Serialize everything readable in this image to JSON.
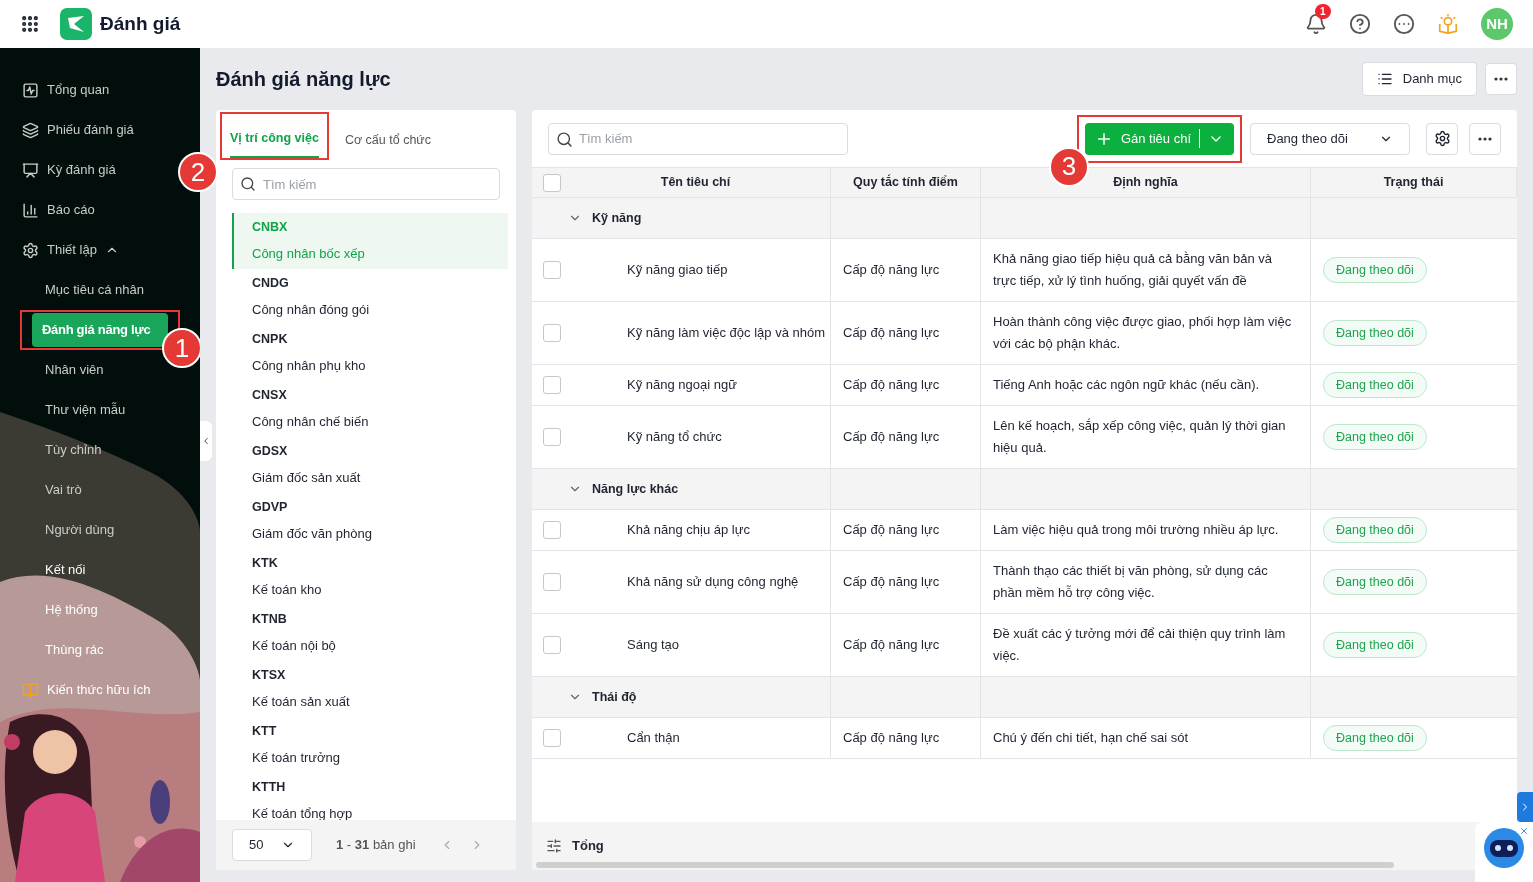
{
  "app": {
    "title": "Đánh giá",
    "notification_count": "1",
    "avatar": "NH"
  },
  "sidebar": {
    "items": [
      {
        "label": "Tổng quan",
        "selected": false
      },
      {
        "label": "Phiếu đánh giá",
        "selected": false
      },
      {
        "label": "Kỳ đánh giá",
        "selected": false
      },
      {
        "label": "Báo cáo",
        "selected": false
      },
      {
        "label": "Thiết lập",
        "selected": false,
        "expanded": true,
        "children": [
          {
            "label": "Mục tiêu cá nhân",
            "selected": false
          },
          {
            "label": "Đánh giá năng lực",
            "selected": true,
            "step": "1"
          },
          {
            "label": "Nhân viên",
            "selected": false
          },
          {
            "label": "Thư viện mẫu",
            "selected": false
          },
          {
            "label": "Tùy chỉnh",
            "selected": false
          },
          {
            "label": "Vai trò",
            "selected": false
          },
          {
            "label": "Người dùng",
            "selected": false
          },
          {
            "label": "Kết nối",
            "selected": false
          },
          {
            "label": "Hệ thống",
            "selected": false
          },
          {
            "label": "Thùng rác",
            "selected": false
          }
        ]
      },
      {
        "label": "Kiến thức hữu ích",
        "selected": false
      }
    ]
  },
  "page": {
    "title": "Đánh giá năng lực",
    "menu_button": "Danh mục"
  },
  "left_panel": {
    "tabs": [
      {
        "label": "Vị trí công việc",
        "selected": true,
        "step": "2"
      },
      {
        "label": "Cơ cấu tổ chức",
        "selected": false
      }
    ],
    "search": {
      "placeholder": "Tìm kiếm"
    },
    "positions": [
      {
        "code": "CNBX",
        "name": "Công nhân bốc xếp",
        "selected": true
      },
      {
        "code": "CNDG",
        "name": "Công nhân đóng gói",
        "selected": false
      },
      {
        "code": "CNPK",
        "name": "Công nhân phụ kho",
        "selected": false
      },
      {
        "code": "CNSX",
        "name": "Công nhân chế biến",
        "selected": false
      },
      {
        "code": "GDSX",
        "name": "Giám đốc sản xuất",
        "selected": false
      },
      {
        "code": "GDVP",
        "name": "Giám đốc văn phòng",
        "selected": false
      },
      {
        "code": "KTK",
        "name": "Kế toán kho",
        "selected": false
      },
      {
        "code": "KTNB",
        "name": "Kế toán nội bộ",
        "selected": false
      },
      {
        "code": "KTSX",
        "name": "Kế toán sản xuất",
        "selected": false
      },
      {
        "code": "KTT",
        "name": "Kế toán trưởng",
        "selected": false
      },
      {
        "code": "KTTH",
        "name": "Kế toán tổng hợp",
        "selected": false
      }
    ],
    "page_size": "50",
    "range": "**1** - **31** bản ghi"
  },
  "right_panel": {
    "search": {
      "placeholder": "Tìm kiếm"
    },
    "add_button": {
      "label": "Gán tiêu chí",
      "step": "3"
    },
    "filter": "Đang theo dõi",
    "all_checked": false,
    "columns": [
      "Tên tiêu chí",
      "Quy tắc tính điểm",
      "Định nghĩa",
      "Trạng thái"
    ],
    "groups": [
      {
        "name": "Kỹ năng",
        "expanded": true,
        "rows": [
          {
            "name": "Kỹ năng giao tiếp",
            "rule": "Cấp độ năng lực",
            "definition": "Khả năng giao tiếp hiệu quả cả bằng văn bản và trực tiếp, xử lý tình huống, giải quyết vấn đề",
            "status": "Đang theo dõi",
            "checked": false
          },
          {
            "name": "Kỹ năng làm việc độc lập và nhóm",
            "rule": "Cấp độ năng lực",
            "definition": "Hoàn thành công việc được giao, phối hợp làm việc với các bộ phận khác.",
            "status": "Đang theo dõi",
            "checked": false
          },
          {
            "name": "Kỹ năng ngoại ngữ",
            "rule": "Cấp độ năng lực",
            "definition": "Tiếng Anh hoặc các ngôn ngữ khác (nếu cần).",
            "status": "Đang theo dõi",
            "checked": false
          },
          {
            "name": "Kỹ năng tổ chức",
            "rule": "Cấp độ năng lực",
            "definition": "Lên kế hoạch, sắp xếp công việc, quản lý thời gian hiệu quả.",
            "status": "Đang theo dõi",
            "checked": false
          }
        ]
      },
      {
        "name": "Năng lực khác",
        "expanded": true,
        "rows": [
          {
            "name": "Khả năng chịu áp lực",
            "rule": "Cấp độ năng lực",
            "definition": "Làm việc hiệu quả trong môi trường nhiều áp lực.",
            "status": "Đang theo dõi",
            "checked": false
          },
          {
            "name": "Khả năng sử dụng công nghệ",
            "rule": "Cấp độ năng lực",
            "definition": "Thành thạo các thiết bị văn phòng, sử dụng các phần mềm hỗ trợ công việc.",
            "status": "Đang theo dõi",
            "checked": false
          },
          {
            "name": "Sáng tạo",
            "rule": "Cấp độ năng lực",
            "definition": "Đề xuất các ý tưởng mới để cải thiện quy trình làm việc.",
            "status": "Đang theo dõi",
            "checked": false
          }
        ]
      },
      {
        "name": "Thái độ",
        "expanded": true,
        "rows": [
          {
            "name": "Cẩn thận",
            "rule": "Cấp độ năng lực",
            "definition": "Chú ý đến chi tiết, hạn chế sai sót",
            "status": "Đang theo dõi",
            "checked": false
          }
        ]
      }
    ],
    "footer": "Tổng"
  }
}
